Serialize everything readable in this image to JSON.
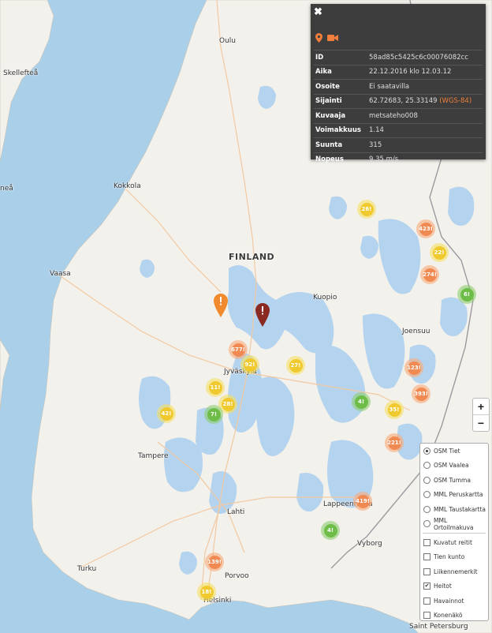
{
  "map": {
    "places": [
      {
        "name": "Oulu",
        "big": false
      },
      {
        "name": "Skellefteå",
        "big": false
      },
      {
        "name": "Kokkola",
        "big": false
      },
      {
        "name": "neå",
        "big": false
      },
      {
        "name": "FINLAND",
        "big": true
      },
      {
        "name": "Vaasa",
        "big": false
      },
      {
        "name": "Kuopio",
        "big": false
      },
      {
        "name": "Joensuu",
        "big": false
      },
      {
        "name": "Jyväskylä",
        "big": false
      },
      {
        "name": "Tampere",
        "big": false
      },
      {
        "name": "Lahti",
        "big": false
      },
      {
        "name": "Lappeenranta",
        "big": false
      },
      {
        "name": "Vyborg",
        "big": false
      },
      {
        "name": "Turku",
        "big": false
      },
      {
        "name": "Porvoo",
        "big": false
      },
      {
        "name": "Helsinki",
        "big": false
      },
      {
        "name": "Saint Petersburg",
        "big": false
      }
    ],
    "clusters": [
      {
        "label": "26",
        "color": "yellow"
      },
      {
        "label": "423",
        "color": "orange"
      },
      {
        "label": "22",
        "color": "yellow"
      },
      {
        "label": "274",
        "color": "orange"
      },
      {
        "label": "6",
        "color": "green"
      },
      {
        "label": "677",
        "color": "orange"
      },
      {
        "label": "92",
        "color": "yellow"
      },
      {
        "label": "27",
        "color": "yellow"
      },
      {
        "label": "123",
        "color": "orange"
      },
      {
        "label": "393",
        "color": "orange"
      },
      {
        "label": "11",
        "color": "yellow"
      },
      {
        "label": "28",
        "color": "yellow"
      },
      {
        "label": "7",
        "color": "green"
      },
      {
        "label": "42",
        "color": "yellow"
      },
      {
        "label": "4",
        "color": "green"
      },
      {
        "label": "35",
        "color": "yellow"
      },
      {
        "label": "221",
        "color": "orange"
      },
      {
        "label": "419",
        "color": "orange"
      },
      {
        "label": "4",
        "color": "green"
      },
      {
        "label": "139",
        "color": "orange"
      },
      {
        "label": "18",
        "color": "yellow"
      }
    ],
    "pins": [
      {
        "name": "orange-marker-icon",
        "color": "#f08a2c"
      },
      {
        "name": "selected-marker-icon",
        "color": "#8a2a22"
      }
    ]
  },
  "popup": {
    "close_icon": "close-icon",
    "icons": [
      "location-pin-icon",
      "video-camera-icon"
    ],
    "rows": [
      {
        "key": "ID",
        "value": "58ad85c5425c6c00076082cc"
      },
      {
        "key": "Aika",
        "value": "22.12.2016 klo 12.03.12"
      },
      {
        "key": "Osoite",
        "value": "Ei saatavilla"
      },
      {
        "key": "Sijainti",
        "value": "62.72683, 25.33149",
        "extra": "(WGS-84)"
      },
      {
        "key": "Kuvaaja",
        "value": "metsateho008"
      },
      {
        "key": "Voimakkuus",
        "value": "1.14"
      },
      {
        "key": "Suunta",
        "value": "315"
      },
      {
        "key": "Nopeus",
        "value": "9.35 m/s"
      }
    ]
  },
  "zoom": {
    "in_label": "+",
    "out_label": "−"
  },
  "layers": {
    "base": [
      {
        "label": "OSM Tiet",
        "selected": true
      },
      {
        "label": "OSM Vaalea",
        "selected": false
      },
      {
        "label": "OSM Tumma",
        "selected": false
      },
      {
        "label": "MML Peruskartta",
        "selected": false
      },
      {
        "label": "MML Taustakartta",
        "selected": false
      },
      {
        "label": "MML Ortoilmakuva",
        "selected": false
      }
    ],
    "overlays": [
      {
        "label": "Kuvatut reitit",
        "checked": false
      },
      {
        "label": "Tien kunto",
        "checked": false
      },
      {
        "label": "Liikennemerkit",
        "checked": false
      },
      {
        "label": "Heitot",
        "checked": true
      },
      {
        "label": "Havainnot",
        "checked": false
      },
      {
        "label": "Konenäkö",
        "checked": false
      }
    ]
  },
  "colors": {
    "sea": "#a9cfe9",
    "land": "#f3f1ec",
    "lake": "#b4d3ee",
    "popup_bg": "#3d3d3d",
    "accent": "#f07f3c"
  }
}
